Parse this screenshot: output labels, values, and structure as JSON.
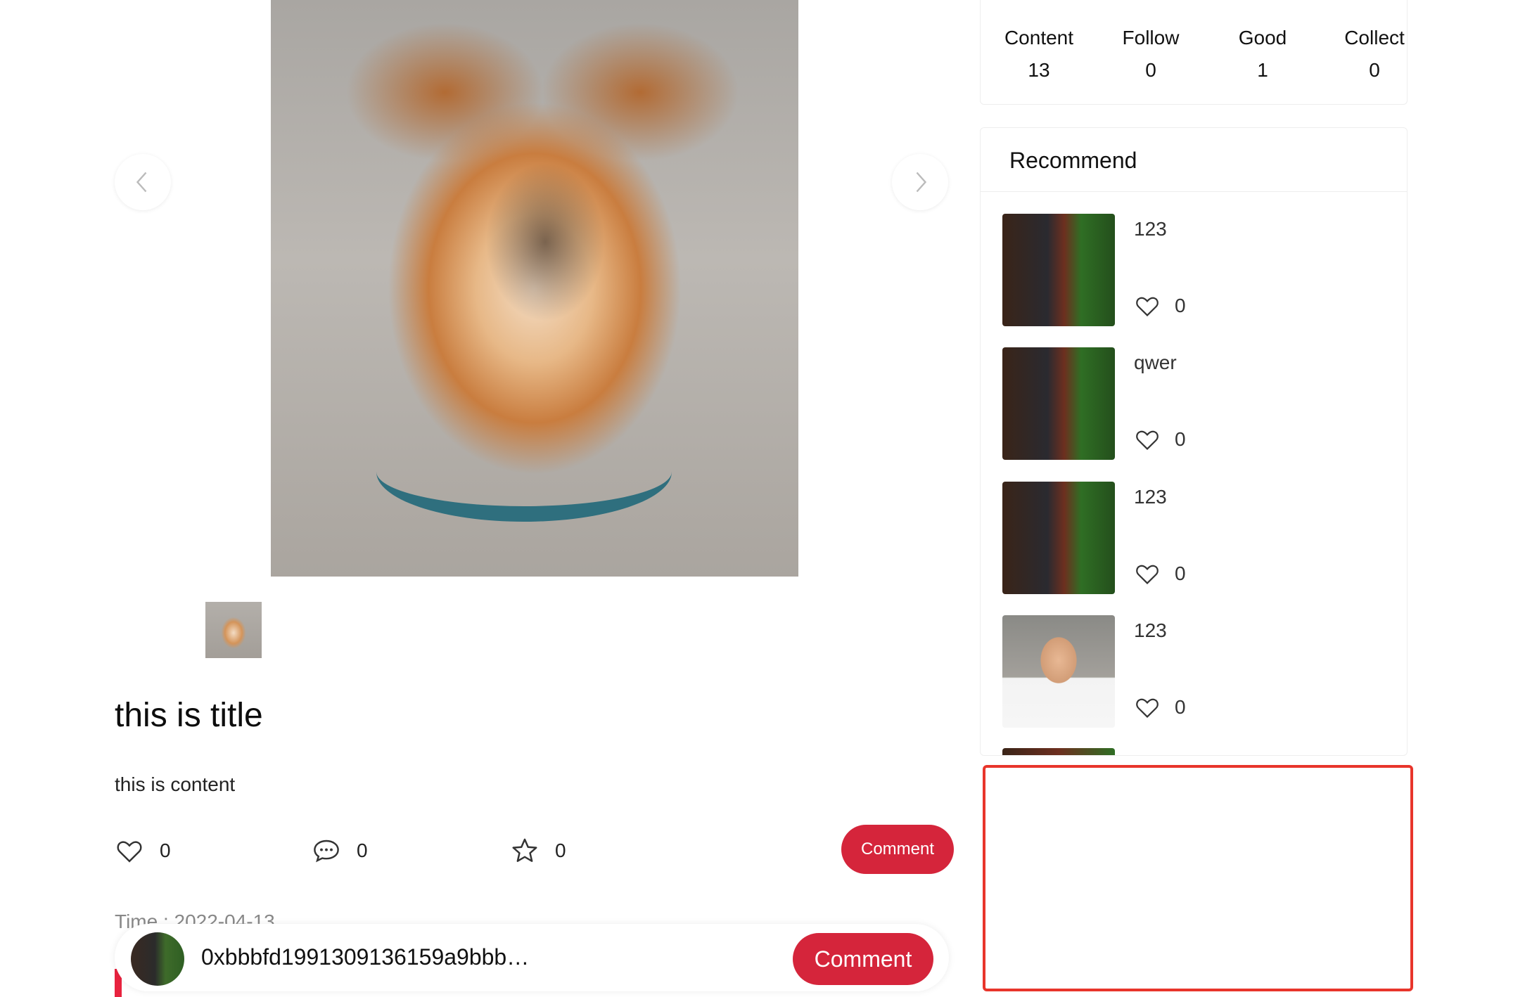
{
  "post": {
    "title": "this is title",
    "content": "this is content",
    "likes": "0",
    "comments": "0",
    "collects": "0",
    "comment_button": "Comment",
    "time_label": "Time : 2022-04-13"
  },
  "comment_bar": {
    "address": "0xbbbfd1991309136159a9bbb…",
    "button": "Comment"
  },
  "stats": [
    {
      "label": "Content",
      "value": "13"
    },
    {
      "label": "Follow",
      "value": "0"
    },
    {
      "label": "Good",
      "value": "1"
    },
    {
      "label": "Collect",
      "value": "0"
    }
  ],
  "recommend": {
    "title": "Recommend",
    "items": [
      {
        "title": "123",
        "likes": "0"
      },
      {
        "title": "qwer",
        "likes": "0"
      },
      {
        "title": "123",
        "likes": "0"
      },
      {
        "title": "123",
        "likes": "0"
      }
    ]
  },
  "colors": {
    "accent": "#d5253b",
    "highlight_border": "#e8352b"
  },
  "icons": [
    "chevron-left-icon",
    "chevron-right-icon",
    "heart-icon",
    "comment-icon",
    "star-icon"
  ]
}
